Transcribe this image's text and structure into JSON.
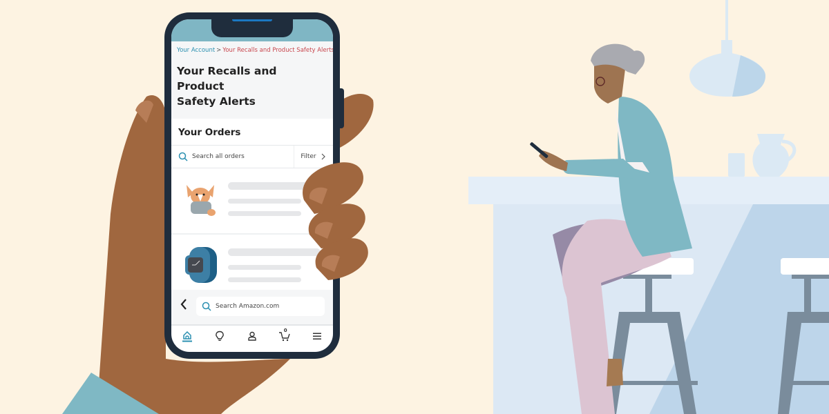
{
  "breadcrumb": {
    "parent": "Your Account",
    "separator": ">",
    "current": "Your Recalls and Product Safety Alerts"
  },
  "page": {
    "title_line1": "Your Recalls and Product",
    "title_line2": "Safety Alerts"
  },
  "orders": {
    "heading": "Your Orders",
    "search_placeholder": "Search all orders",
    "filter_label": "Filter",
    "items": [
      {
        "product": "corgi-plush-toy"
      },
      {
        "product": "smart-watch"
      }
    ]
  },
  "bottom_bar": {
    "search_placeholder": "Search Amazon.com"
  },
  "nav": {
    "items": [
      "home",
      "inspire",
      "account",
      "cart",
      "menu"
    ],
    "cart_count": "0",
    "active": "home"
  },
  "colors": {
    "background": "#fdf3e2",
    "link": "#2a8fb0",
    "alert_red": "#c8464d",
    "accent_blue": "#1b78c2",
    "phone_frame": "#1f2d3d"
  }
}
